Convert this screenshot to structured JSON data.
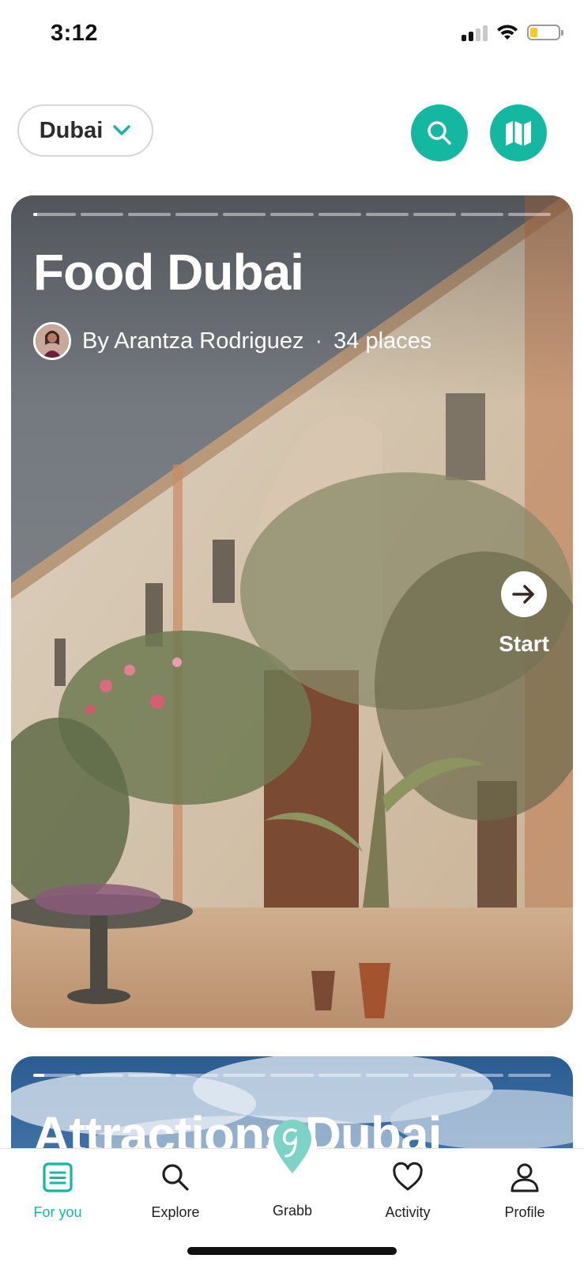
{
  "status_bar": {
    "time": "3:12",
    "battery_level": 0.25,
    "battery_color": "#f7cc20"
  },
  "header": {
    "city": "Dubai",
    "city_chevron_icon": "chevron-down-icon",
    "search_icon": "search-icon",
    "map_icon": "map-icon",
    "accent_color": "#14b8a1"
  },
  "cards": [
    {
      "title": "Food Dubai",
      "author": "By Arantza Rodriguez",
      "separator": "·",
      "places": "34 places",
      "start_label": "Start",
      "progress_segments": 11,
      "progress_active_fill": 0.1
    },
    {
      "title": "Attractions Dubai",
      "progress_segments": 11,
      "progress_active_fill": 0.25
    }
  ],
  "bottom_nav": {
    "items": [
      {
        "label": "For you",
        "icon": "list-icon",
        "active": true
      },
      {
        "label": "Explore",
        "icon": "search-icon",
        "active": false
      },
      {
        "label": "Grabb",
        "icon": "grabb-logo-icon",
        "active": false
      },
      {
        "label": "Activity",
        "icon": "heart-icon",
        "active": false
      },
      {
        "label": "Profile",
        "icon": "person-icon",
        "active": false
      }
    ]
  }
}
